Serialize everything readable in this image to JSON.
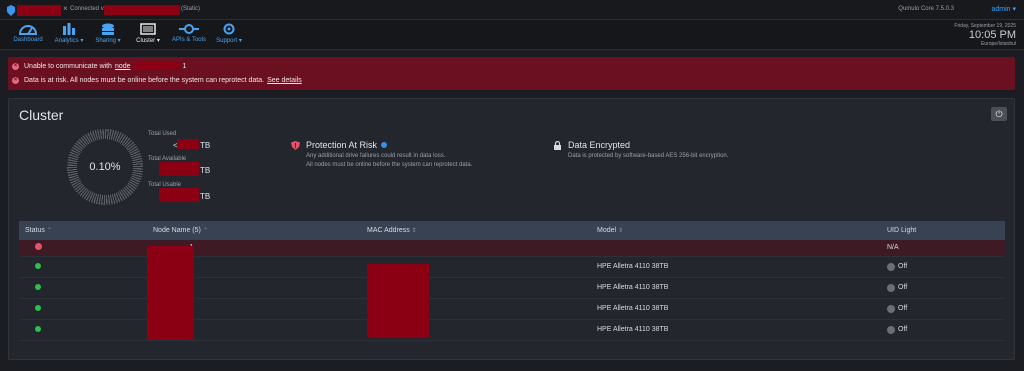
{
  "topbar": {
    "connected_text": "Connected via",
    "static_text": "(Static)",
    "version": "Qumulo Core 7.5.0.3",
    "admin": "admin"
  },
  "nav": [
    {
      "label": "Dashboard",
      "icon": "dashboard-icon"
    },
    {
      "label": "Analytics ▾",
      "icon": "analytics-icon"
    },
    {
      "label": "Sharing ▾",
      "icon": "sharing-icon"
    },
    {
      "label": "Cluster ▾",
      "icon": "cluster-icon"
    },
    {
      "label": "APIs & Tools",
      "icon": "api-tools-icon"
    },
    {
      "label": "Support ▾",
      "icon": "support-icon"
    }
  ],
  "datetime": {
    "date": "Friday, September 19, 2025",
    "time": "10:05 PM",
    "tz": "Europe/Istanbul"
  },
  "alerts": [
    {
      "text": "Unable to communicate with",
      "link": "node",
      "suffix": "1"
    },
    {
      "text": "Data is at risk. All nodes must be online before the system can reprotect data.",
      "link": "See details"
    }
  ],
  "cluster": {
    "title": "Cluster",
    "usage_percent": "0.10%",
    "total_used_label": "Total Used",
    "total_used_value": "<",
    "total_available_label": "Total Available",
    "total_usable_label": "Total Usable",
    "unit": "TB",
    "protection_title": "Protection At Risk",
    "protection_line1": "Any additional drive failures could result in data loss.",
    "protection_line2": "All nodes must be online before the system can reprotect data.",
    "encrypted_title": "Data Encrypted",
    "encrypted_line": "Data is protected by software-based AES 256-bit encryption."
  },
  "table": {
    "headers": [
      "Status",
      "Node Name (5)",
      "MAC Address",
      "Model",
      "UID Light"
    ],
    "rows": [
      {
        "name": "-1",
        "model": "",
        "uid": "N/A",
        "status": "error"
      },
      {
        "name": "-2",
        "model": "HPE Alletra 4110 38TB",
        "uid": "Off",
        "status": "ok"
      },
      {
        "name": "-3",
        "model": "HPE Alletra 4110 38TB",
        "uid": "Off",
        "status": "ok"
      },
      {
        "name": "-4",
        "model": "HPE Alletra 4110 38TB",
        "uid": "Off",
        "status": "ok"
      },
      {
        "name": "-5",
        "model": "HPE Alletra 4110 38TB",
        "uid": "Off",
        "status": "ok"
      }
    ]
  },
  "colors": {
    "accent": "#3a95ee",
    "alert_bg": "#6a1021",
    "ok": "#2ebf4f",
    "error": "#e2546a"
  }
}
